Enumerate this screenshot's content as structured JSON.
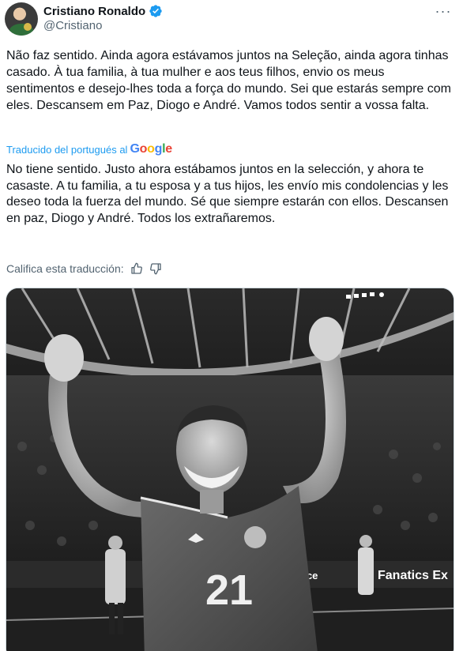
{
  "user": {
    "display_name": "Cristiano Ronaldo",
    "handle": "@Cristiano",
    "verified": true,
    "avatar_icon": "profile-avatar"
  },
  "menu": {
    "icon": "more-options-icon",
    "label": "···"
  },
  "tweet": {
    "text": "Não faz sentido. Ainda agora estávamos juntos na Seleção, ainda agora tinhas casado. À tua familia, à tua mulher e aos teus filhos, envio os meus sentimentos e desejo-lhes toda a força do mundo. Sei que estarás sempre com eles. Descansem em Paz, Diogo e André. Vamos todos sentir a vossa falta."
  },
  "translation": {
    "label": "Traducido del portugués al",
    "provider": {
      "part1": "G",
      "part2": "o",
      "part3": "o",
      "part4": "g",
      "part5": "l",
      "part6": "e"
    },
    "text": "No tiene sentido. Justo ahora estábamos juntos en la selección, y ahora te casaste. A tu familia, a tu esposa y a tus hijos, les envío mis condolencias y les deseo toda la fuerza del mundo. Sé que siempre estarán con ellos. Descansen en paz, Diogo y André. Todos los extrañaremos.",
    "rate_label": "Califica esta traducción:",
    "thumbs_up_icon": "thumbs-up-icon",
    "thumbs_down_icon": "thumbs-down-icon"
  },
  "media": {
    "jersey_number": "21",
    "sponsor_text": "Fanatics Ex",
    "board_text": "nce",
    "colors": {
      "accent": "#1d9bf0",
      "verified": "#1d9bf0",
      "muted": "#536471"
    }
  }
}
